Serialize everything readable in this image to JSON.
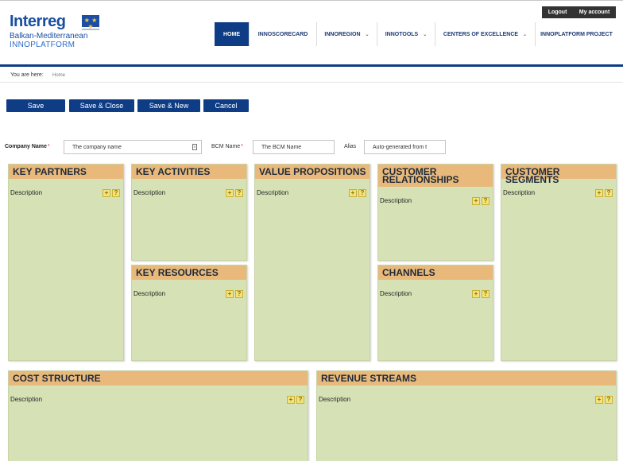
{
  "header": {
    "logo": {
      "brand": "Interreg",
      "region": "Balkan-Mediterranean",
      "project": "INNOPLATFORM"
    },
    "account": {
      "logout": "Logout",
      "my_account": "My account"
    },
    "nav": [
      {
        "label": "HOME",
        "active": true,
        "caret": false
      },
      {
        "label": "INNOSCORECARD",
        "active": false,
        "caret": false
      },
      {
        "label": "INNOREGION",
        "active": false,
        "caret": true
      },
      {
        "label": "INNOTOOLS",
        "active": false,
        "caret": true
      },
      {
        "label": "CENTERS OF EXCELLENCE",
        "active": false,
        "caret": true
      },
      {
        "label": "INNOPLATFORM PROJECT",
        "active": false,
        "caret": false
      }
    ]
  },
  "breadcrumb": {
    "label": "You are here:",
    "home": "Home"
  },
  "toolbar": {
    "save": "Save",
    "save_close": "Save & Close",
    "save_new": "Save & New",
    "cancel": "Cancel"
  },
  "form": {
    "company_label": "Company Name",
    "company_placeholder": "The company name",
    "bcm_label": "BCM Name",
    "bcm_placeholder": "The BCM Name",
    "alias_label": "Alias",
    "alias_placeholder": "Auto-generated from t",
    "required_mark": "*"
  },
  "canvas": {
    "description_label": "Description",
    "add_symbol": "+",
    "help_symbol": "?",
    "blocks": {
      "key_partners": "KEY PARTNERS",
      "key_activities": "KEY ACTIVITIES",
      "key_resources": "KEY RESOURCES",
      "value_propositions": "VALUE PROPOSITIONS",
      "customer_relationships_line1": "CUSTOMER",
      "customer_relationships_line2": "RELATIONSHIPS",
      "channels": "CHANNELS",
      "customer_segments": "CUSTOMER SEGMENTS",
      "cost_structure": "COST STRUCTURE",
      "revenue_streams": "REVENUE STREAMS"
    }
  },
  "colors": {
    "brand_blue": "#0e3d86",
    "block_body": "#d6e2b6",
    "block_header": "#e8b97a"
  }
}
